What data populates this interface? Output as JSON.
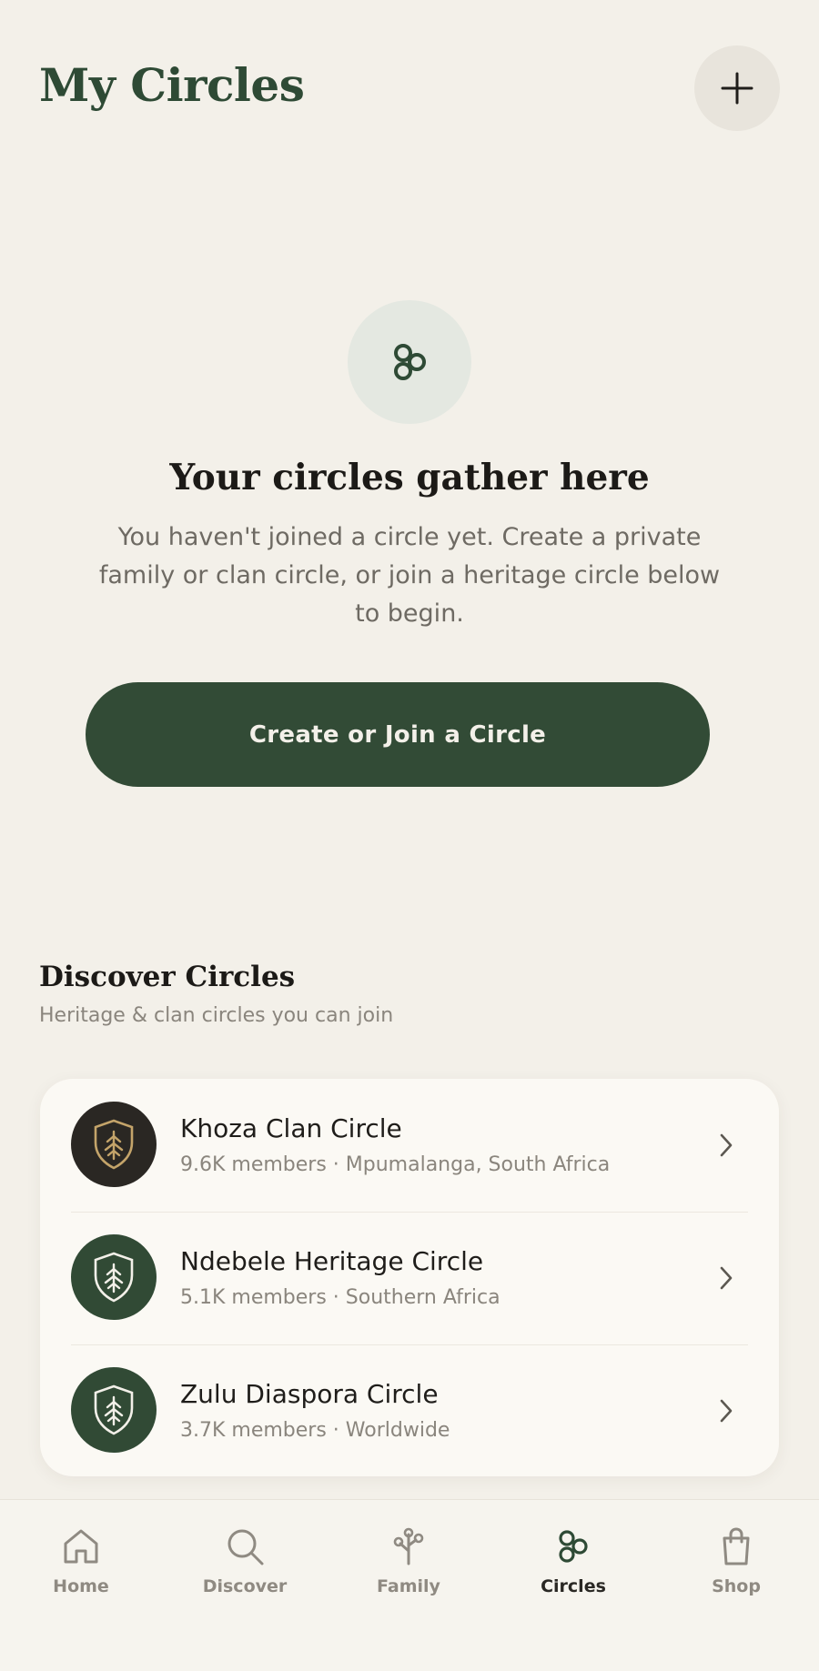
{
  "header": {
    "title": "My Circles",
    "add_icon": "plus-icon"
  },
  "empty_state": {
    "icon": "circles-icon",
    "title": "Your circles gather here",
    "text": "You haven't joined a circle yet. Create a private family or clan circle, or join a heritage circle below to begin.",
    "cta_label": "Create or Join a Circle"
  },
  "discover": {
    "title": "Discover Circles",
    "subtitle": "Heritage & clan circles you can join",
    "items": [
      {
        "name": "Khoza Clan Circle",
        "meta": "9.6K members · Mpumalanga, South Africa",
        "icon": "shield-tree-icon",
        "avatar_color": "#2a2723",
        "emblem_color": "#c4a46a"
      },
      {
        "name": "Ndebele Heritage Circle",
        "meta": "5.1K members · Southern Africa",
        "icon": "shield-tree-icon",
        "avatar_color": "#314a35",
        "emblem_color": "#f3f0e9"
      },
      {
        "name": "Zulu Diaspora Circle",
        "meta": "3.7K members · Worldwide",
        "icon": "shield-tree-icon",
        "avatar_color": "#314a35",
        "emblem_color": "#f3f0e9"
      }
    ]
  },
  "tabs": [
    {
      "label": "Home",
      "icon": "home-icon",
      "active": false
    },
    {
      "label": "Discover",
      "icon": "search-icon",
      "active": false
    },
    {
      "label": "Family",
      "icon": "family-tree-icon",
      "active": false
    },
    {
      "label": "Circles",
      "icon": "circles-icon",
      "active": true
    },
    {
      "label": "Shop",
      "icon": "shopping-bag-icon",
      "active": false
    }
  ],
  "colors": {
    "background": "#f3f0e9",
    "brand_green": "#324b36",
    "card": "#fbf9f4"
  }
}
